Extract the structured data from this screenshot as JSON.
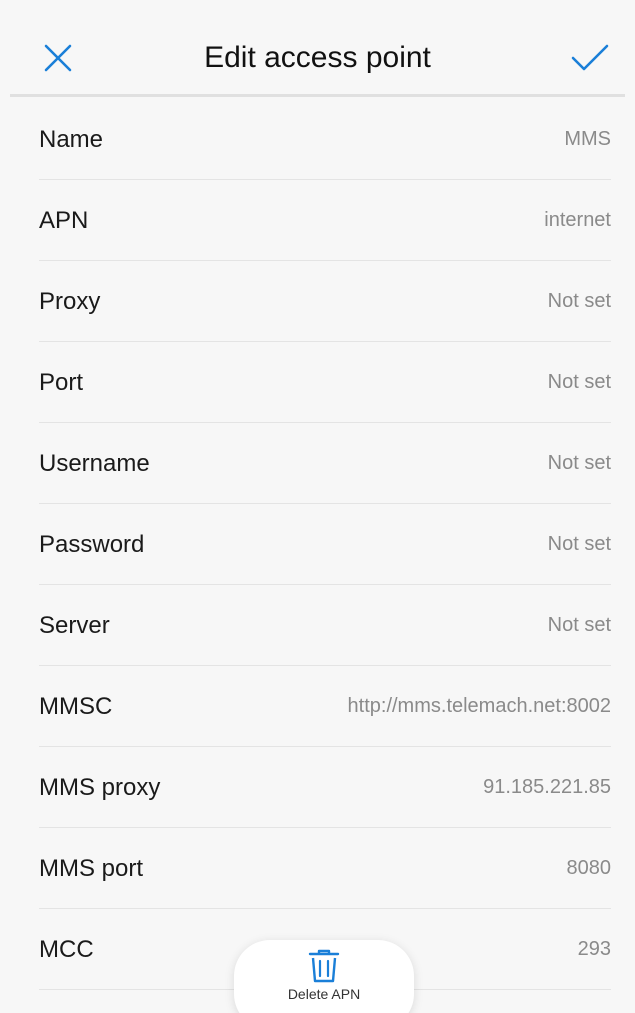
{
  "header": {
    "title": "Edit access point",
    "close_icon": "close-icon",
    "confirm_icon": "checkmark-icon"
  },
  "accent_color": "#1a7fd8",
  "rows": [
    {
      "label": "Name",
      "value": "MMS"
    },
    {
      "label": "APN",
      "value": "internet"
    },
    {
      "label": "Proxy",
      "value": "Not set"
    },
    {
      "label": "Port",
      "value": "Not set"
    },
    {
      "label": "Username",
      "value": "Not set"
    },
    {
      "label": "Password",
      "value": "Not set"
    },
    {
      "label": "Server",
      "value": "Not set"
    },
    {
      "label": "MMSC",
      "value": "http://mms.telemach.net:8002"
    },
    {
      "label": "MMS proxy",
      "value": "91.185.221.85"
    },
    {
      "label": "MMS port",
      "value": "8080"
    },
    {
      "label": "MCC",
      "value": "293"
    }
  ],
  "delete_action": {
    "label": "Delete APN",
    "icon": "trash-icon"
  }
}
